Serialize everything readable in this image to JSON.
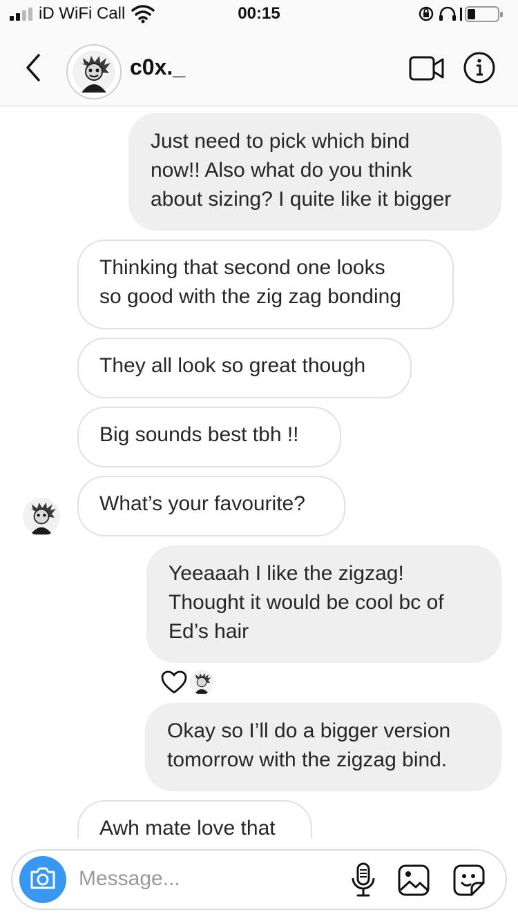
{
  "status_bar": {
    "carrier": "iD WiFi Call",
    "time": "00:15",
    "icons": [
      "signal-icon",
      "wifi-icon",
      "orientation-lock-icon",
      "headphones-icon",
      "battery-icon"
    ]
  },
  "header": {
    "username": "c0x._",
    "icons": [
      "back-chevron-icon",
      "video-call-icon",
      "info-icon"
    ]
  },
  "messages": [
    {
      "side": "outgoing",
      "text": "Just need to pick which bind\nnow!! Also what do you think\nabout sizing? I quite like it bigger"
    },
    {
      "side": "incoming",
      "text": "Thinking that second one looks\nso good with the zig zag bonding"
    },
    {
      "side": "incoming",
      "text": "They all look so great though"
    },
    {
      "side": "incoming",
      "text": "Big sounds best tbh !!"
    },
    {
      "side": "incoming",
      "text": "What’s your favourite?"
    },
    {
      "side": "outgoing",
      "text": "Yeeaaah I like the zigzag!\nThought it would be cool bc of\nEd’s hair"
    },
    {
      "side": "outgoing",
      "text": "Okay so I’ll do a bigger version\ntomorrow with the zigzag bind."
    },
    {
      "side": "incoming",
      "text": "Awh mate love that"
    }
  ],
  "reaction": {
    "icon": "heart-outline-icon"
  },
  "composer": {
    "placeholder": "Message...",
    "icons": [
      "camera-icon",
      "microphone-icon",
      "gallery-icon",
      "sticker-icon"
    ]
  },
  "colors": {
    "accent": "#3897f0",
    "outgoing_bubble": "#efefef",
    "incoming_border": "#e1e1e1"
  }
}
